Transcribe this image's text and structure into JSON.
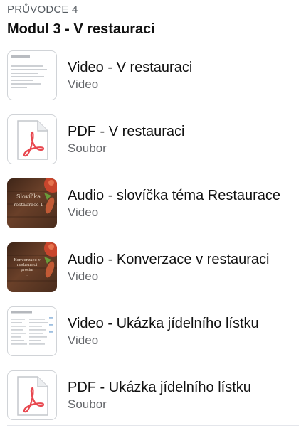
{
  "guide_label": "PRŮVODCE 4",
  "module_title": "Modul 3 - V restauraci",
  "items": [
    {
      "title": "Video - V restauraci",
      "type": "Video",
      "thumb": "video-slide-thumbnail"
    },
    {
      "title": "PDF - V restauraci",
      "type": "Soubor",
      "thumb": "pdf-file-icon"
    },
    {
      "title": "Audio - slovíčka téma Restaurace",
      "type": "Video",
      "thumb": "wood-food-thumbnail",
      "thumb_text": "Slovíčka - restaurace 1"
    },
    {
      "title": "Audio - Konverzace v restauraci",
      "type": "Video",
      "thumb": "wood-food-thumbnail",
      "thumb_text": "Konverzace v restauraci"
    },
    {
      "title": "Video - Ukázka jídelního lístku",
      "type": "Video",
      "thumb": "menu-document-thumbnail"
    },
    {
      "title": "PDF - Ukázka jídelního lístku",
      "type": "Soubor",
      "thumb": "pdf-file-icon"
    }
  ],
  "colors": {
    "pdf_accent": "#e8474f",
    "wood": "#5a3624",
    "tomato": "#c8452c"
  }
}
